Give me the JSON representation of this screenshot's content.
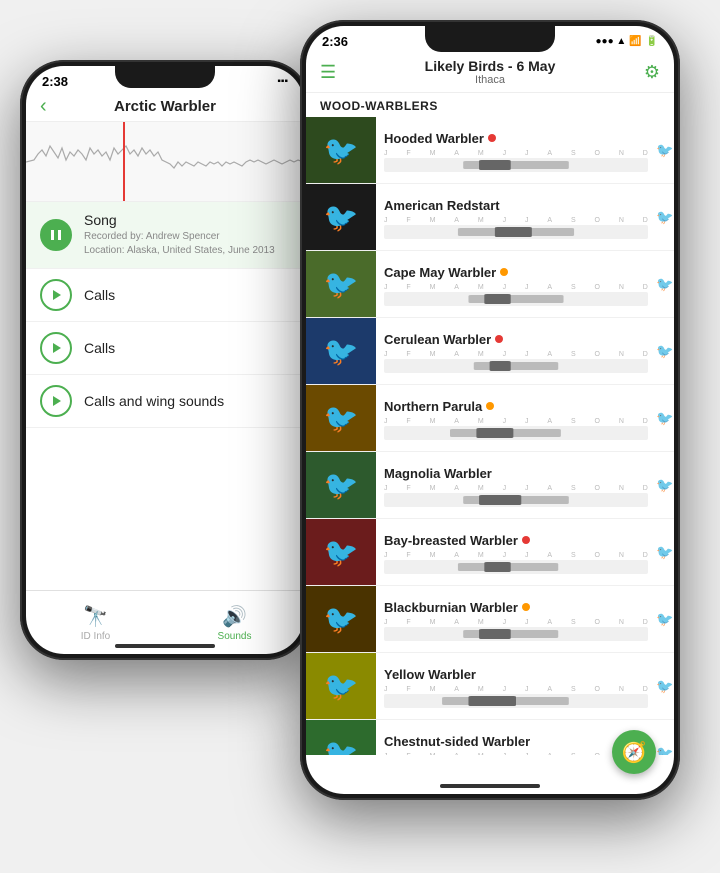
{
  "phone1": {
    "time": "2:38",
    "title": "Arctic Warbler",
    "sounds": [
      {
        "id": "song",
        "label": "Song",
        "active": true,
        "meta": "Recorded by: Andrew Spencer\nLocation: Alaska, United States, June 2013"
      },
      {
        "id": "calls1",
        "label": "Calls",
        "active": false,
        "meta": ""
      },
      {
        "id": "calls2",
        "label": "Calls",
        "active": false,
        "meta": ""
      },
      {
        "id": "calls-wing",
        "label": "Calls and wing sounds",
        "active": false,
        "meta": ""
      }
    ],
    "tabs": [
      {
        "id": "id-info",
        "label": "ID Info",
        "icon": "🔭",
        "active": false
      },
      {
        "id": "sounds",
        "label": "Sounds",
        "icon": "🔊",
        "active": true
      }
    ]
  },
  "phone2": {
    "time": "2:36",
    "title": "Likely Birds - 6 May",
    "subtitle": "Ithaca",
    "section": "WOOD-WARBLERS",
    "birds": [
      {
        "name": "Hooded Warbler",
        "dot": "red",
        "color": "#4CAF50"
      },
      {
        "name": "American Redstart",
        "dot": "none",
        "color": "#4CAF50"
      },
      {
        "name": "Cape May Warbler",
        "dot": "orange",
        "color": "#4CAF50"
      },
      {
        "name": "Cerulean Warbler",
        "dot": "red",
        "color": "#4CAF50"
      },
      {
        "name": "Northern Parula",
        "dot": "orange",
        "color": "#4CAF50"
      },
      {
        "name": "Magnolia Warbler",
        "dot": "none",
        "color": "#4CAF50"
      },
      {
        "name": "Bay-breasted Warbler",
        "dot": "red",
        "color": "#4CAF50"
      },
      {
        "name": "Blackburnian Warbler",
        "dot": "orange",
        "color": "#4CAF50"
      },
      {
        "name": "Yellow Warbler",
        "dot": "none",
        "color": "#4CAF50"
      },
      {
        "name": "Chestnut-sided Warbler",
        "dot": "none",
        "color": "#4CAF50"
      }
    ],
    "months": [
      "J",
      "F",
      "M",
      "A",
      "M",
      "J",
      "J",
      "A",
      "S",
      "O",
      "N",
      "D"
    ],
    "bird_colors": [
      "#c8b400",
      "#111",
      "#8bc34a",
      "#1e88e5",
      "#ff9800",
      "#4caf50",
      "#b71c1c",
      "#ff6f00",
      "#fdd835",
      "#66bb6a"
    ]
  }
}
